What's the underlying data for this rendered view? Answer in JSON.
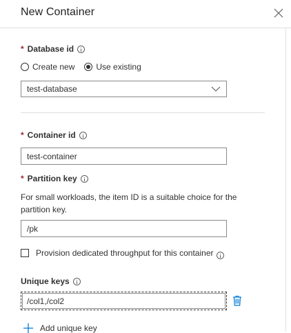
{
  "panel": {
    "title": "New Container"
  },
  "database": {
    "label": "Database id",
    "radio_create_new": "Create new",
    "radio_use_existing": "Use existing",
    "selected_radio": "use_existing",
    "selected_value": "test-database"
  },
  "container": {
    "label": "Container id",
    "value": "test-container"
  },
  "partition": {
    "label": "Partition key",
    "help": "For small workloads, the item ID is a suitable choice for the partition key.",
    "value": "/pk"
  },
  "throughput": {
    "label": "Provision dedicated throughput for this container",
    "checked": false
  },
  "unique_keys": {
    "label": "Unique keys",
    "value": "/col1,/col2",
    "add_label": "Add unique key"
  },
  "colors": {
    "required": "#a4262c",
    "accent": "#0078d4",
    "border": "#8a8886",
    "divider": "#e1dfdd"
  },
  "icons": {
    "close": "close-icon",
    "info": "info-icon",
    "chevron": "chevron-down-icon",
    "delete": "trash-icon",
    "add": "plus-icon"
  }
}
